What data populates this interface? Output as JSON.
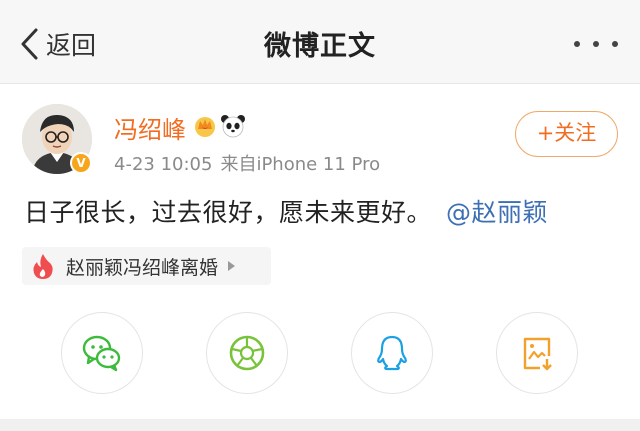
{
  "nav": {
    "back_label": "返回",
    "title": "微博正文"
  },
  "post": {
    "author": "冯绍峰",
    "time": "4-23 10:05",
    "source": "来自iPhone 11 Pro",
    "follow_label": "+关注",
    "text": "日子很长，过去很好，愿未来更好。",
    "mention": "@赵丽颖",
    "topic": "赵丽颖冯绍峰离婚"
  },
  "share": {
    "icons": [
      "wechat-icon",
      "moments-icon",
      "qq-icon",
      "save-image-icon"
    ]
  },
  "colors": {
    "accent": "#f26d22",
    "link": "#3d6fb5",
    "meta": "#8a8a8a",
    "wechat": "#3dbb3d",
    "moments": "#78c33a",
    "qq": "#1ba1e2",
    "save": "#f2a22b"
  }
}
